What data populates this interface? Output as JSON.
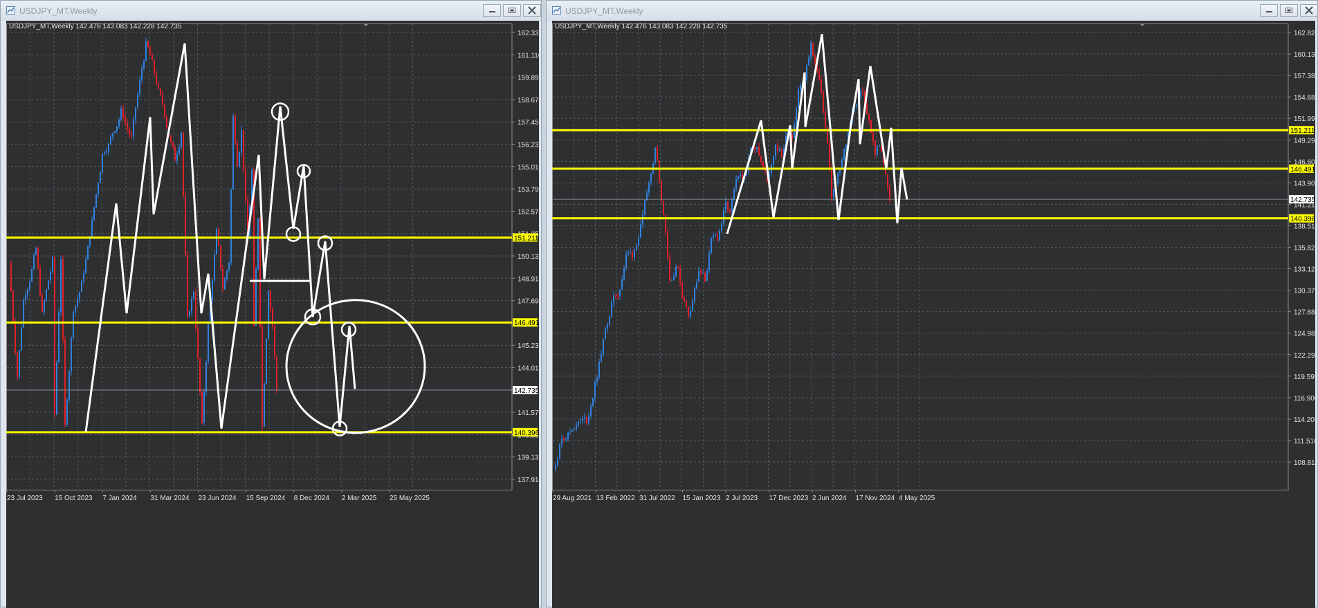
{
  "windows": [
    {
      "title": "USDJPY_MT,Weekly",
      "chart_data": {
        "type": "candlestick",
        "info": "USDJPY_MT,Weekly  142.476 143.083 142.228 142.735",
        "ylim": [
          137.2,
          163.1
        ],
        "y_ticks": [
          "162.330",
          "161.110",
          "159.890",
          "158.670",
          "157.450",
          "156.230",
          "155.010",
          "153.790",
          "152.570",
          "151.350",
          "150.130",
          "148.910",
          "147.690",
          "146.470",
          "145.230",
          "144.010",
          "142.790",
          "141.570",
          "140.350",
          "139.130",
          "137.910"
        ],
        "x_ticks": [
          "23 Jul 2023",
          "15 Oct 2023",
          "7 Jan 2024",
          "31 Mar 2024",
          "23 Jun 2024",
          "15 Sep 2024",
          "8 Dec 2024",
          "2 Mar 2025",
          "25 May 2025"
        ],
        "last_price": 142.735,
        "last_price_label": "142.735",
        "levels": [
          {
            "value": 151.211,
            "label": "151.211"
          },
          {
            "value": 146.491,
            "label": "146.491"
          },
          {
            "value": 140.396,
            "label": "140.396"
          }
        ],
        "points": [
          [
            0,
            149.8
          ],
          [
            12,
            143.5
          ],
          [
            8,
            147.7
          ],
          [
            18,
            150.6
          ],
          [
            8,
            146.9
          ],
          [
            14,
            149.9
          ],
          [
            4,
            141.4
          ],
          [
            10,
            150.1
          ],
          [
            5,
            140.7
          ],
          [
            12,
            147.3
          ],
          [
            11,
            148.6
          ],
          [
            10,
            150.6
          ],
          [
            20,
            155.8
          ],
          [
            28,
            158.2
          ],
          [
            14,
            156.7
          ],
          [
            20,
            161.9
          ],
          [
            12,
            160.4
          ],
          [
            30,
            155.6
          ],
          [
            8,
            157.1
          ],
          [
            8,
            146.6
          ],
          [
            8,
            148.3
          ],
          [
            12,
            140.7
          ],
          [
            8,
            146.3
          ],
          [
            12,
            151.5
          ],
          [
            8,
            148.4
          ],
          [
            9,
            149.9
          ],
          [
            7,
            157.9
          ],
          [
            5,
            155.4
          ],
          [
            6,
            157.1
          ],
          [
            9,
            151.1
          ],
          [
            5,
            154.9
          ],
          [
            3,
            146.1
          ],
          [
            7,
            152.4
          ],
          [
            5,
            140.7
          ],
          [
            10,
            148.4
          ],
          [
            6,
            146.3
          ],
          [
            7,
            142.75
          ]
        ],
        "annotations": {
          "zigzag": [
            [
              123,
              140.4
            ],
            [
              167,
              153.1
            ],
            [
              182,
              147.0
            ],
            [
              216,
              157.9
            ],
            [
              221,
              152.5
            ],
            [
              266,
              162.0
            ],
            [
              290,
              147.0
            ],
            [
              300,
              149.2
            ],
            [
              319,
              140.6
            ],
            [
              373,
              155.8
            ],
            [
              381,
              148.9
            ],
            [
              404,
              158.5
            ],
            [
              423,
              151.7
            ],
            [
              438,
              155.2
            ],
            [
              451,
              146.8
            ],
            [
              469,
              151.0
            ],
            [
              490,
              140.7
            ],
            [
              504,
              146.3
            ],
            [
              512,
              142.8
            ]
          ],
          "neckline": [
            [
              360,
              148.8
            ],
            [
              447,
              148.8
            ]
          ],
          "circles": [
            [
              404,
              158.2,
              12
            ],
            [
              423,
              151.4,
              10
            ],
            [
              438,
              154.9,
              9
            ],
            [
              469,
              150.9,
              10
            ],
            [
              451,
              146.8,
              11
            ],
            [
              503,
              146.1,
              10
            ],
            [
              490,
              140.6,
              10
            ]
          ],
          "big_circle": [
            513,
            144.05,
            100,
            96
          ]
        }
      }
    },
    {
      "title": "USDJPY_MT,Weekly",
      "chart_data": {
        "type": "candlestick",
        "info": "USDJPY_MT,Weekly  142.476 143.083 142.228 142.735",
        "ylim": [
          107.1,
          164.3
        ],
        "y_ticks": [
          "162.825",
          "160.130",
          "157.380",
          "154.685",
          "151.990",
          "149.295",
          "146.600",
          "143.905",
          "141.210",
          "138.515",
          "135.820",
          "133.125",
          "130.375",
          "127.680",
          "124.985",
          "122.290",
          "119.595",
          "116.900",
          "114.205",
          "111.510",
          "108.815"
        ],
        "x_ticks": [
          "29 Aug 2021",
          "13 Feb 2022",
          "31 Jul 2022",
          "15 Jan 2023",
          "2 Jul 2023",
          "17 Dec 2023",
          "2 Jun 2024",
          "17 Nov 2024",
          "4 May 2025"
        ],
        "last_price": 142.735,
        "last_price_label": "142.735",
        "levels": [
          {
            "value": 151.211,
            "label": "151.211"
          },
          {
            "value": 146.491,
            "label": "146.491"
          },
          {
            "value": 140.396,
            "label": "140.396"
          }
        ],
        "points": [
          [
            0,
            109.6
          ],
          [
            12,
            113.7
          ],
          [
            12,
            114.3
          ],
          [
            10,
            115.3
          ],
          [
            14,
            115.6
          ],
          [
            14,
            121.3
          ],
          [
            12,
            126.6
          ],
          [
            10,
            129.8
          ],
          [
            9,
            131.1
          ],
          [
            12,
            135.7
          ],
          [
            8,
            136.0
          ],
          [
            15,
            140.4
          ],
          [
            8,
            144.7
          ],
          [
            8,
            149.4
          ],
          [
            6,
            145.3
          ],
          [
            10,
            139.0
          ],
          [
            6,
            132.8
          ],
          [
            12,
            134.7
          ],
          [
            7,
            131.0
          ],
          [
            8,
            128.6
          ],
          [
            10,
            131.7
          ],
          [
            6,
            133.6
          ],
          [
            8,
            132.9
          ],
          [
            10,
            137.5
          ],
          [
            10,
            138.1
          ],
          [
            12,
            142.1
          ],
          [
            6,
            140.8
          ],
          [
            10,
            144.8
          ],
          [
            10,
            145.2
          ],
          [
            12,
            148.8
          ],
          [
            8,
            149.5
          ],
          [
            16,
            145.0
          ],
          [
            12,
            149.6
          ],
          [
            8,
            148.2
          ],
          [
            10,
            151.4
          ],
          [
            6,
            150.5
          ],
          [
            10,
            156.3
          ],
          [
            10,
            157.4
          ],
          [
            9,
            161.6
          ],
          [
            11,
            157.3
          ],
          [
            12,
            149.5
          ],
          [
            6,
            143.2
          ],
          [
            12,
            146.3
          ],
          [
            8,
            149.6
          ],
          [
            10,
            153.7
          ],
          [
            6,
            154.6
          ],
          [
            8,
            156.1
          ],
          [
            9,
            152.3
          ],
          [
            9,
            148.3
          ],
          [
            7,
            149.7
          ],
          [
            9,
            145.5
          ],
          [
            6,
            142.75
          ]
        ],
        "annotations": {
          "zigzag": [
            [
              1050,
              138.5
            ],
            [
              1099,
              152.4
            ],
            [
              1117,
              140.5
            ],
            [
              1141,
              151.8
            ],
            [
              1144,
              146.5
            ],
            [
              1162,
              158.3
            ],
            [
              1163,
              151.6
            ],
            [
              1187,
              163.0
            ],
            [
              1211,
              140.2
            ],
            [
              1229,
              152.0
            ],
            [
              1240,
              157.5
            ],
            [
              1242,
              149.5
            ],
            [
              1257,
              159.1
            ],
            [
              1280,
              146.5
            ],
            [
              1287,
              151.5
            ],
            [
              1296,
              139.8
            ],
            [
              1302,
              146.6
            ],
            [
              1310,
              142.7
            ]
          ],
          "neckline": [],
          "circles": [],
          "big_circle": []
        }
      }
    }
  ]
}
